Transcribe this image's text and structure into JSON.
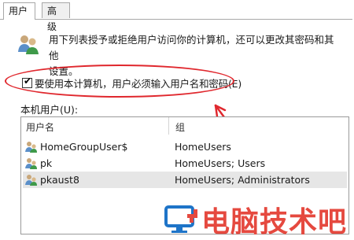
{
  "tabs": [
    {
      "label": "用户",
      "active": true
    },
    {
      "label": "高级",
      "active": false
    }
  ],
  "description": {
    "line1": "用下列表授予或拒绝用户访问你的计算机，还可以更改其密码和其他",
    "line2": "设置。"
  },
  "checkbox": {
    "label": "要使用本计算机，用户必须输入用户名和密码(E)",
    "checked": true
  },
  "users_section_label": "本机用户(U):",
  "table": {
    "headers": {
      "name": "用户名",
      "group": "组"
    },
    "rows": [
      {
        "name": "HomeGroupUser$",
        "group": "HomeUsers",
        "selected": false
      },
      {
        "name": "pk",
        "group": "HomeUsers; Users",
        "selected": false
      },
      {
        "name": "pkaust8",
        "group": "HomeUsers; Administrators",
        "selected": true
      }
    ]
  },
  "watermark": {
    "text": "电脑技术吧"
  },
  "colors": {
    "annotation_red": "#e0282e",
    "watermark_red": "#e5493f"
  }
}
